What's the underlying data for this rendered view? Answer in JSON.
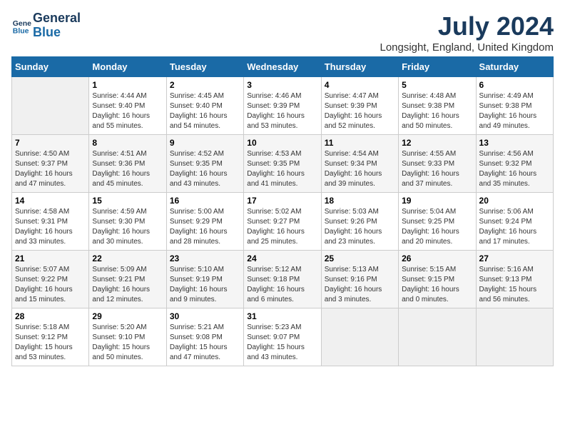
{
  "logo": {
    "line1": "General",
    "line2": "Blue"
  },
  "title": "July 2024",
  "location": "Longsight, England, United Kingdom",
  "weekdays": [
    "Sunday",
    "Monday",
    "Tuesday",
    "Wednesday",
    "Thursday",
    "Friday",
    "Saturday"
  ],
  "weeks": [
    [
      {
        "day": "",
        "info": ""
      },
      {
        "day": "1",
        "info": "Sunrise: 4:44 AM\nSunset: 9:40 PM\nDaylight: 16 hours\nand 55 minutes."
      },
      {
        "day": "2",
        "info": "Sunrise: 4:45 AM\nSunset: 9:40 PM\nDaylight: 16 hours\nand 54 minutes."
      },
      {
        "day": "3",
        "info": "Sunrise: 4:46 AM\nSunset: 9:39 PM\nDaylight: 16 hours\nand 53 minutes."
      },
      {
        "day": "4",
        "info": "Sunrise: 4:47 AM\nSunset: 9:39 PM\nDaylight: 16 hours\nand 52 minutes."
      },
      {
        "day": "5",
        "info": "Sunrise: 4:48 AM\nSunset: 9:38 PM\nDaylight: 16 hours\nand 50 minutes."
      },
      {
        "day": "6",
        "info": "Sunrise: 4:49 AM\nSunset: 9:38 PM\nDaylight: 16 hours\nand 49 minutes."
      }
    ],
    [
      {
        "day": "7",
        "info": "Sunrise: 4:50 AM\nSunset: 9:37 PM\nDaylight: 16 hours\nand 47 minutes."
      },
      {
        "day": "8",
        "info": "Sunrise: 4:51 AM\nSunset: 9:36 PM\nDaylight: 16 hours\nand 45 minutes."
      },
      {
        "day": "9",
        "info": "Sunrise: 4:52 AM\nSunset: 9:35 PM\nDaylight: 16 hours\nand 43 minutes."
      },
      {
        "day": "10",
        "info": "Sunrise: 4:53 AM\nSunset: 9:35 PM\nDaylight: 16 hours\nand 41 minutes."
      },
      {
        "day": "11",
        "info": "Sunrise: 4:54 AM\nSunset: 9:34 PM\nDaylight: 16 hours\nand 39 minutes."
      },
      {
        "day": "12",
        "info": "Sunrise: 4:55 AM\nSunset: 9:33 PM\nDaylight: 16 hours\nand 37 minutes."
      },
      {
        "day": "13",
        "info": "Sunrise: 4:56 AM\nSunset: 9:32 PM\nDaylight: 16 hours\nand 35 minutes."
      }
    ],
    [
      {
        "day": "14",
        "info": "Sunrise: 4:58 AM\nSunset: 9:31 PM\nDaylight: 16 hours\nand 33 minutes."
      },
      {
        "day": "15",
        "info": "Sunrise: 4:59 AM\nSunset: 9:30 PM\nDaylight: 16 hours\nand 30 minutes."
      },
      {
        "day": "16",
        "info": "Sunrise: 5:00 AM\nSunset: 9:29 PM\nDaylight: 16 hours\nand 28 minutes."
      },
      {
        "day": "17",
        "info": "Sunrise: 5:02 AM\nSunset: 9:27 PM\nDaylight: 16 hours\nand 25 minutes."
      },
      {
        "day": "18",
        "info": "Sunrise: 5:03 AM\nSunset: 9:26 PM\nDaylight: 16 hours\nand 23 minutes."
      },
      {
        "day": "19",
        "info": "Sunrise: 5:04 AM\nSunset: 9:25 PM\nDaylight: 16 hours\nand 20 minutes."
      },
      {
        "day": "20",
        "info": "Sunrise: 5:06 AM\nSunset: 9:24 PM\nDaylight: 16 hours\nand 17 minutes."
      }
    ],
    [
      {
        "day": "21",
        "info": "Sunrise: 5:07 AM\nSunset: 9:22 PM\nDaylight: 16 hours\nand 15 minutes."
      },
      {
        "day": "22",
        "info": "Sunrise: 5:09 AM\nSunset: 9:21 PM\nDaylight: 16 hours\nand 12 minutes."
      },
      {
        "day": "23",
        "info": "Sunrise: 5:10 AM\nSunset: 9:19 PM\nDaylight: 16 hours\nand 9 minutes."
      },
      {
        "day": "24",
        "info": "Sunrise: 5:12 AM\nSunset: 9:18 PM\nDaylight: 16 hours\nand 6 minutes."
      },
      {
        "day": "25",
        "info": "Sunrise: 5:13 AM\nSunset: 9:16 PM\nDaylight: 16 hours\nand 3 minutes."
      },
      {
        "day": "26",
        "info": "Sunrise: 5:15 AM\nSunset: 9:15 PM\nDaylight: 16 hours\nand 0 minutes."
      },
      {
        "day": "27",
        "info": "Sunrise: 5:16 AM\nSunset: 9:13 PM\nDaylight: 15 hours\nand 56 minutes."
      }
    ],
    [
      {
        "day": "28",
        "info": "Sunrise: 5:18 AM\nSunset: 9:12 PM\nDaylight: 15 hours\nand 53 minutes."
      },
      {
        "day": "29",
        "info": "Sunrise: 5:20 AM\nSunset: 9:10 PM\nDaylight: 15 hours\nand 50 minutes."
      },
      {
        "day": "30",
        "info": "Sunrise: 5:21 AM\nSunset: 9:08 PM\nDaylight: 15 hours\nand 47 minutes."
      },
      {
        "day": "31",
        "info": "Sunrise: 5:23 AM\nSunset: 9:07 PM\nDaylight: 15 hours\nand 43 minutes."
      },
      {
        "day": "",
        "info": ""
      },
      {
        "day": "",
        "info": ""
      },
      {
        "day": "",
        "info": ""
      }
    ]
  ]
}
